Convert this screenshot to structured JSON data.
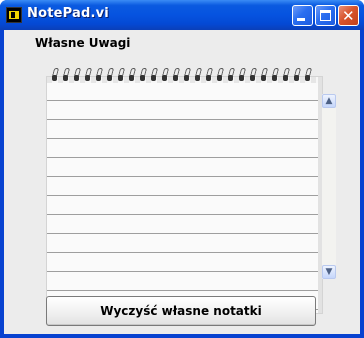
{
  "window": {
    "title": "NotePad.vi",
    "title_bar_color": "#0653e0",
    "close_button_color": "#d8542c"
  },
  "main": {
    "heading": "Własne Uwagi",
    "notes_text": "",
    "clear_button_label": "Wyczyść własne notatki"
  },
  "icons": {
    "app": "labview-vi-icon",
    "minimize": "minimize-icon",
    "maximize": "maximize-icon",
    "close": "close-icon",
    "scroll_up": "scroll-up-arrow-icon",
    "scroll_down": "scroll-down-arrow-icon"
  }
}
